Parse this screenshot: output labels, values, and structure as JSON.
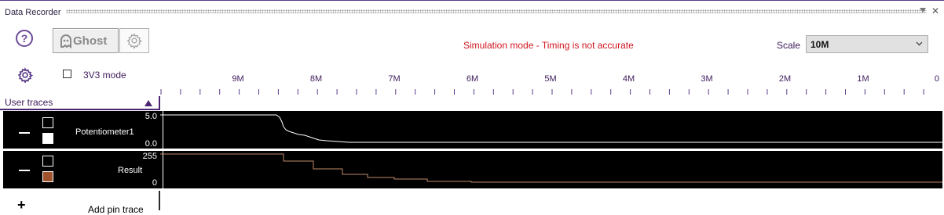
{
  "window": {
    "title": "Data Recorder",
    "close_glyph": "✕",
    "pin_icon": "pin-icon"
  },
  "toolbar": {
    "help_glyph": "?",
    "ghost_label": "Ghost",
    "ghost_icon": "ghost-icon",
    "ghost_settings_icon": "gear-icon"
  },
  "status": {
    "simulation_message": "Simulation mode - Timing is not accurate",
    "color": "#d0141e"
  },
  "scale": {
    "label": "Scale",
    "selected": "10M"
  },
  "options": {
    "mode_3v3_label": "3V3 mode",
    "mode_3v3_checked": false
  },
  "timeline": {
    "tick_labels": [
      "9M",
      "8M",
      "7M",
      "6M",
      "5M",
      "4M",
      "3M",
      "2M",
      "1M",
      "0"
    ]
  },
  "user_traces": {
    "header": "User traces",
    "collapse_icon": "triangle-up-icon",
    "traces": [
      {
        "name": "Potentiometer1",
        "max": "5.0",
        "min": "0.0",
        "swatch_color": "#ffffff",
        "line_color": "#ffffff"
      },
      {
        "name": "Result",
        "max": "255",
        "min": "0",
        "swatch_color": "#a0522d",
        "line_color": "#c08a6a"
      }
    ]
  },
  "add_pin_trace": {
    "label": "Add pin trace"
  }
}
